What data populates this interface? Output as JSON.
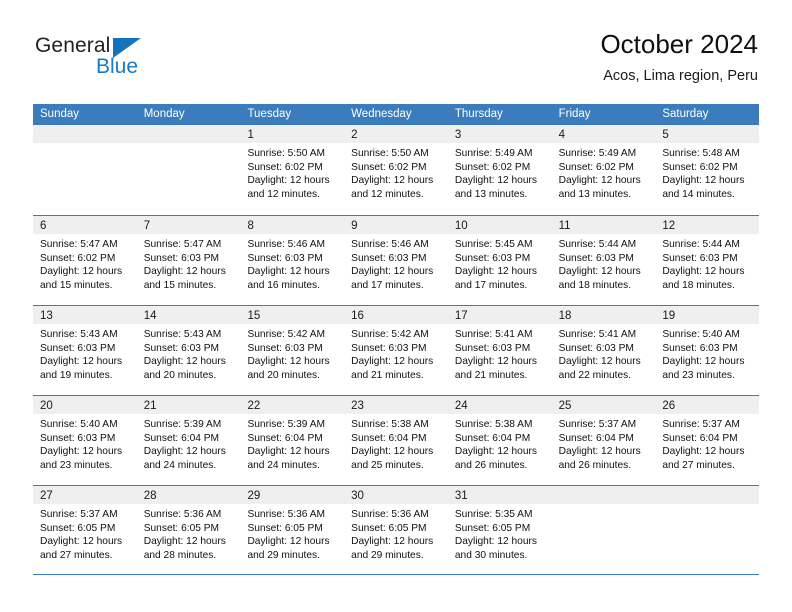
{
  "brand": {
    "name_top": "General",
    "name_bottom": "Blue",
    "triangle_color": "#1573bc",
    "blue_text_color": "#1a7ac4"
  },
  "header": {
    "title": "October 2024",
    "subtitle": "Acos, Lima region, Peru"
  },
  "theme": {
    "header_blue": "#3b7cbd",
    "daynum_band_gray": "#efefef",
    "text_color": "#111111"
  },
  "calendar": {
    "weekday_headers": [
      "Sunday",
      "Monday",
      "Tuesday",
      "Wednesday",
      "Thursday",
      "Friday",
      "Saturday"
    ],
    "weeks": [
      [
        {
          "day": "",
          "lines": []
        },
        {
          "day": "",
          "lines": []
        },
        {
          "day": "1",
          "lines": [
            "Sunrise: 5:50 AM",
            "Sunset: 6:02 PM",
            "Daylight: 12 hours",
            "and 12 minutes."
          ]
        },
        {
          "day": "2",
          "lines": [
            "Sunrise: 5:50 AM",
            "Sunset: 6:02 PM",
            "Daylight: 12 hours",
            "and 12 minutes."
          ]
        },
        {
          "day": "3",
          "lines": [
            "Sunrise: 5:49 AM",
            "Sunset: 6:02 PM",
            "Daylight: 12 hours",
            "and 13 minutes."
          ]
        },
        {
          "day": "4",
          "lines": [
            "Sunrise: 5:49 AM",
            "Sunset: 6:02 PM",
            "Daylight: 12 hours",
            "and 13 minutes."
          ]
        },
        {
          "day": "5",
          "lines": [
            "Sunrise: 5:48 AM",
            "Sunset: 6:02 PM",
            "Daylight: 12 hours",
            "and 14 minutes."
          ]
        }
      ],
      [
        {
          "day": "6",
          "lines": [
            "Sunrise: 5:47 AM",
            "Sunset: 6:02 PM",
            "Daylight: 12 hours",
            "and 15 minutes."
          ]
        },
        {
          "day": "7",
          "lines": [
            "Sunrise: 5:47 AM",
            "Sunset: 6:03 PM",
            "Daylight: 12 hours",
            "and 15 minutes."
          ]
        },
        {
          "day": "8",
          "lines": [
            "Sunrise: 5:46 AM",
            "Sunset: 6:03 PM",
            "Daylight: 12 hours",
            "and 16 minutes."
          ]
        },
        {
          "day": "9",
          "lines": [
            "Sunrise: 5:46 AM",
            "Sunset: 6:03 PM",
            "Daylight: 12 hours",
            "and 17 minutes."
          ]
        },
        {
          "day": "10",
          "lines": [
            "Sunrise: 5:45 AM",
            "Sunset: 6:03 PM",
            "Daylight: 12 hours",
            "and 17 minutes."
          ]
        },
        {
          "day": "11",
          "lines": [
            "Sunrise: 5:44 AM",
            "Sunset: 6:03 PM",
            "Daylight: 12 hours",
            "and 18 minutes."
          ]
        },
        {
          "day": "12",
          "lines": [
            "Sunrise: 5:44 AM",
            "Sunset: 6:03 PM",
            "Daylight: 12 hours",
            "and 18 minutes."
          ]
        }
      ],
      [
        {
          "day": "13",
          "lines": [
            "Sunrise: 5:43 AM",
            "Sunset: 6:03 PM",
            "Daylight: 12 hours",
            "and 19 minutes."
          ]
        },
        {
          "day": "14",
          "lines": [
            "Sunrise: 5:43 AM",
            "Sunset: 6:03 PM",
            "Daylight: 12 hours",
            "and 20 minutes."
          ]
        },
        {
          "day": "15",
          "lines": [
            "Sunrise: 5:42 AM",
            "Sunset: 6:03 PM",
            "Daylight: 12 hours",
            "and 20 minutes."
          ]
        },
        {
          "day": "16",
          "lines": [
            "Sunrise: 5:42 AM",
            "Sunset: 6:03 PM",
            "Daylight: 12 hours",
            "and 21 minutes."
          ]
        },
        {
          "day": "17",
          "lines": [
            "Sunrise: 5:41 AM",
            "Sunset: 6:03 PM",
            "Daylight: 12 hours",
            "and 21 minutes."
          ]
        },
        {
          "day": "18",
          "lines": [
            "Sunrise: 5:41 AM",
            "Sunset: 6:03 PM",
            "Daylight: 12 hours",
            "and 22 minutes."
          ]
        },
        {
          "day": "19",
          "lines": [
            "Sunrise: 5:40 AM",
            "Sunset: 6:03 PM",
            "Daylight: 12 hours",
            "and 23 minutes."
          ]
        }
      ],
      [
        {
          "day": "20",
          "lines": [
            "Sunrise: 5:40 AM",
            "Sunset: 6:03 PM",
            "Daylight: 12 hours",
            "and 23 minutes."
          ]
        },
        {
          "day": "21",
          "lines": [
            "Sunrise: 5:39 AM",
            "Sunset: 6:04 PM",
            "Daylight: 12 hours",
            "and 24 minutes."
          ]
        },
        {
          "day": "22",
          "lines": [
            "Sunrise: 5:39 AM",
            "Sunset: 6:04 PM",
            "Daylight: 12 hours",
            "and 24 minutes."
          ]
        },
        {
          "day": "23",
          "lines": [
            "Sunrise: 5:38 AM",
            "Sunset: 6:04 PM",
            "Daylight: 12 hours",
            "and 25 minutes."
          ]
        },
        {
          "day": "24",
          "lines": [
            "Sunrise: 5:38 AM",
            "Sunset: 6:04 PM",
            "Daylight: 12 hours",
            "and 26 minutes."
          ]
        },
        {
          "day": "25",
          "lines": [
            "Sunrise: 5:37 AM",
            "Sunset: 6:04 PM",
            "Daylight: 12 hours",
            "and 26 minutes."
          ]
        },
        {
          "day": "26",
          "lines": [
            "Sunrise: 5:37 AM",
            "Sunset: 6:04 PM",
            "Daylight: 12 hours",
            "and 27 minutes."
          ]
        }
      ],
      [
        {
          "day": "27",
          "lines": [
            "Sunrise: 5:37 AM",
            "Sunset: 6:05 PM",
            "Daylight: 12 hours",
            "and 27 minutes."
          ]
        },
        {
          "day": "28",
          "lines": [
            "Sunrise: 5:36 AM",
            "Sunset: 6:05 PM",
            "Daylight: 12 hours",
            "and 28 minutes."
          ]
        },
        {
          "day": "29",
          "lines": [
            "Sunrise: 5:36 AM",
            "Sunset: 6:05 PM",
            "Daylight: 12 hours",
            "and 29 minutes."
          ]
        },
        {
          "day": "30",
          "lines": [
            "Sunrise: 5:36 AM",
            "Sunset: 6:05 PM",
            "Daylight: 12 hours",
            "and 29 minutes."
          ]
        },
        {
          "day": "31",
          "lines": [
            "Sunrise: 5:35 AM",
            "Sunset: 6:05 PM",
            "Daylight: 12 hours",
            "and 30 minutes."
          ]
        },
        {
          "day": "",
          "lines": []
        },
        {
          "day": "",
          "lines": []
        }
      ]
    ]
  }
}
